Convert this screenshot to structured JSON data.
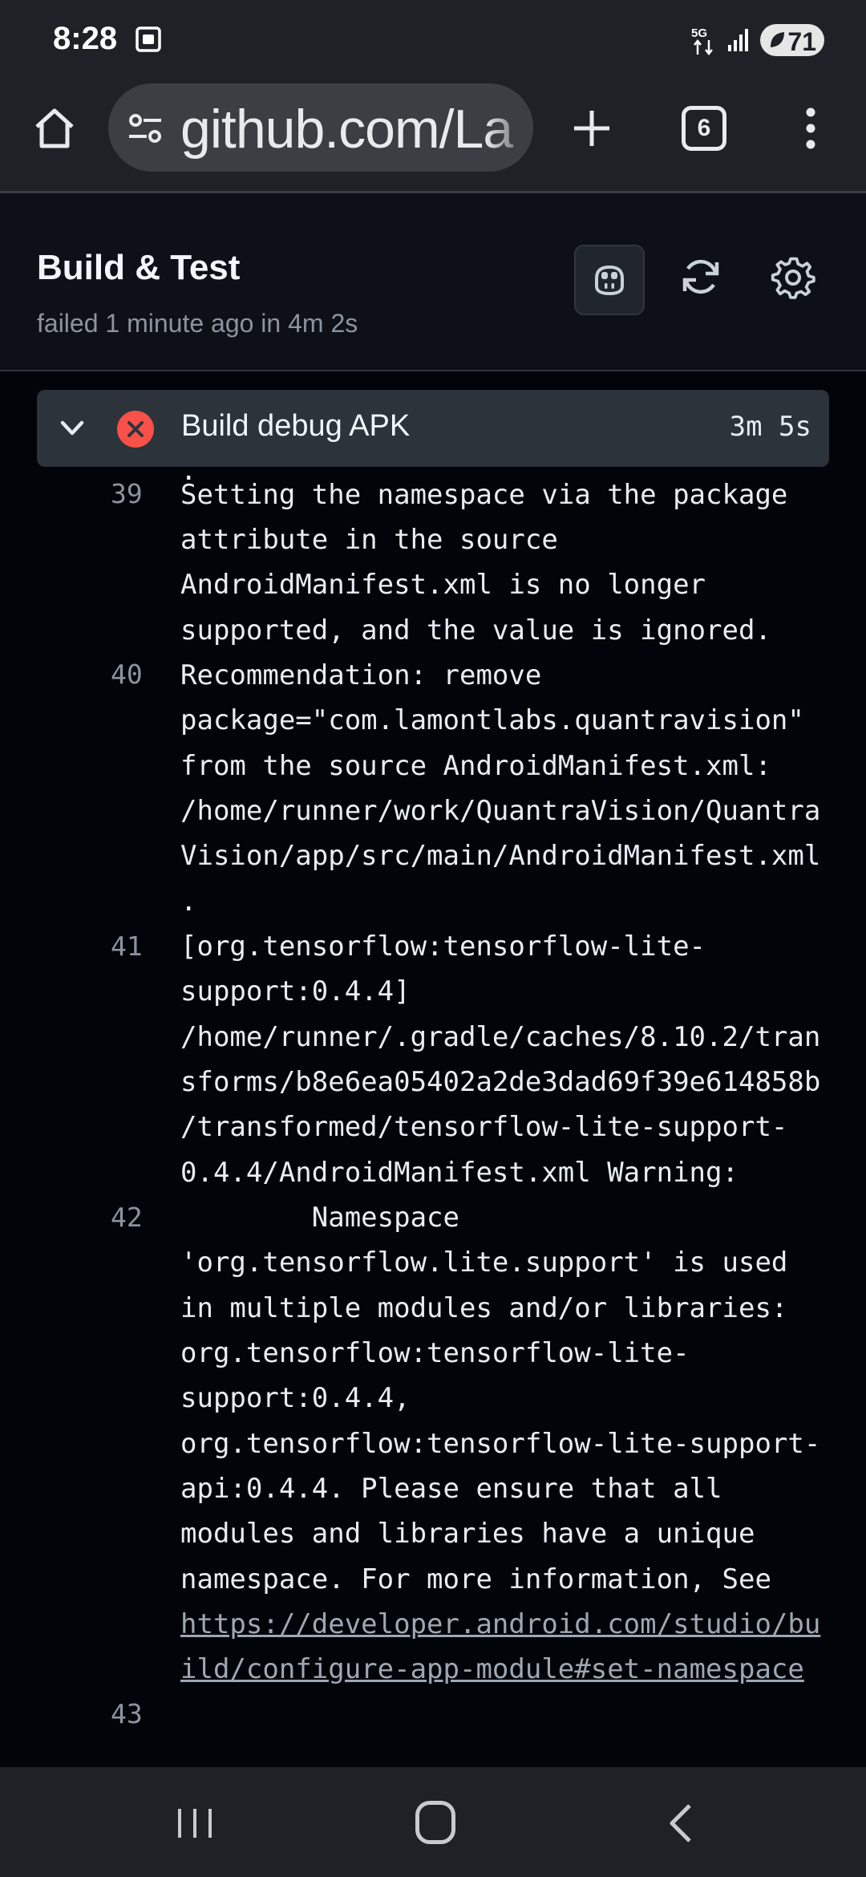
{
  "status_bar": {
    "time": "8:28",
    "network": "5G",
    "battery": "71",
    "icons": [
      "screenshot-icon",
      "5g-icon",
      "signal-icon",
      "battery-icon"
    ]
  },
  "browser": {
    "url": "github.com/La",
    "tab_count": "6",
    "icons": [
      "home-icon",
      "tune-icon",
      "plus-icon",
      "tabs-icon",
      "more-vert-icon"
    ]
  },
  "header": {
    "title": "Build & Test",
    "subtitle": "failed 1 minute ago in 4m 2s",
    "icons": [
      "copilot-icon",
      "rerun-icon",
      "settings-icon"
    ]
  },
  "step": {
    "name": "Build debug APK",
    "duration": "3m 5s",
    "status": "failed"
  },
  "log": {
    "lines": [
      {
        "num": "",
        "rows": [
          "."
        ]
      },
      {
        "num": "39",
        "rows": [
          "Setting the namespace via the package",
          "attribute in the source",
          "AndroidManifest.xml is no longer",
          "supported, and the value is ignored."
        ]
      },
      {
        "num": "40",
        "rows": [
          "Recommendation: remove",
          "package=\"com.lamontlabs.quantravision\"",
          "from the source AndroidManifest.xml:",
          "/home/runner/work/QuantraVision/Quantra",
          "Vision/app/src/main/AndroidManifest.xml",
          "."
        ]
      },
      {
        "num": "41",
        "rows": [
          "[org.tensorflow:tensorflow-lite-",
          "support:0.4.4]",
          "/home/runner/.gradle/caches/8.10.2/tran",
          "sforms/b8e6ea05402a2de3dad69f39e614858b",
          "/transformed/tensorflow-lite-support-",
          "0.4.4/AndroidManifest.xml Warning:"
        ]
      },
      {
        "num": "42",
        "rows": [
          "        Namespace",
          "'org.tensorflow.lite.support' is used",
          "in multiple modules and/or libraries:",
          "org.tensorflow:tensorflow-lite-",
          "support:0.4.4,",
          "org.tensorflow:tensorflow-lite-support-",
          "api:0.4.4. Please ensure that all",
          "modules and libraries have a unique",
          "namespace. For more information, See"
        ]
      },
      {
        "num": "",
        "link_rows": [
          "https://developer.android.com/studio/bu",
          "ild/configure-app-module#set-namespace"
        ]
      },
      {
        "num": "43",
        "rows": [
          ""
        ]
      }
    ]
  },
  "nav": {
    "icons": [
      "recent-apps-icon",
      "home-nav-icon",
      "back-icon"
    ]
  }
}
